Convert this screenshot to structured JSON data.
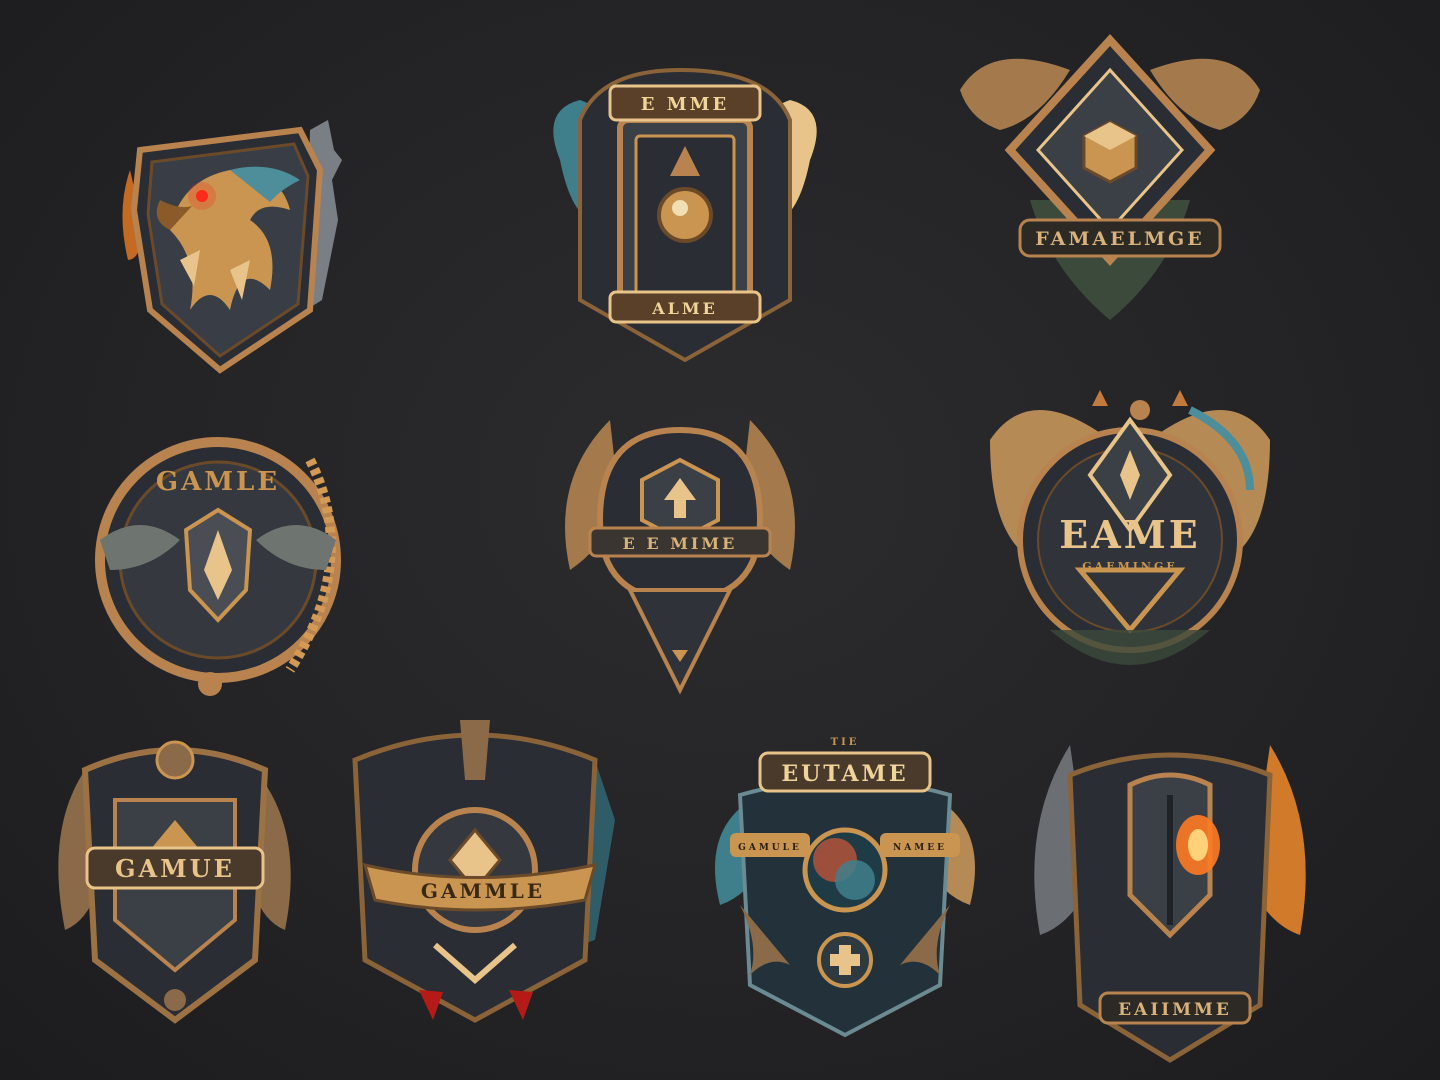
{
  "palette": {
    "background": "#232325",
    "bronze_light": "#e8c48a",
    "bronze": "#b8834e",
    "bronze_dark": "#6b4a2a",
    "steel": "#3b3f46",
    "steel_dark": "#1f2227",
    "teal": "#3f7f8c",
    "ember": "#ff7a22",
    "glow_red": "#ff2a1a"
  },
  "emblems": [
    {
      "id": "e1",
      "icon": "eagle-head-icon",
      "texts": []
    },
    {
      "id": "e2",
      "icon": "twin-eagles-icon",
      "texts": [
        "E MME",
        "ALME"
      ]
    },
    {
      "id": "e3",
      "icon": "diamond-gem-icon",
      "texts": [
        "FAMAELMGE"
      ]
    },
    {
      "id": "e4",
      "icon": "winged-shield-icon",
      "texts": [
        "GAMLE"
      ]
    },
    {
      "id": "e5",
      "icon": "arrow-crest-icon",
      "texts": [
        "E E MIME"
      ]
    },
    {
      "id": "e6",
      "icon": "eagle-pair-icon",
      "texts": [
        "EAME",
        "GAEMINGE"
      ]
    },
    {
      "id": "e7",
      "icon": "winged-plaque-icon",
      "texts": [
        "GAMUE"
      ]
    },
    {
      "id": "e8",
      "icon": "banner-crest-icon",
      "texts": [
        "GAMMLE"
      ]
    },
    {
      "id": "e9",
      "icon": "orb-crest-icon",
      "texts": [
        "EUTAME",
        "TIE",
        "GAMULE",
        "NAMEE"
      ]
    },
    {
      "id": "e10",
      "icon": "phoenix-helm-icon",
      "texts": [
        "EAIIMME"
      ]
    }
  ]
}
